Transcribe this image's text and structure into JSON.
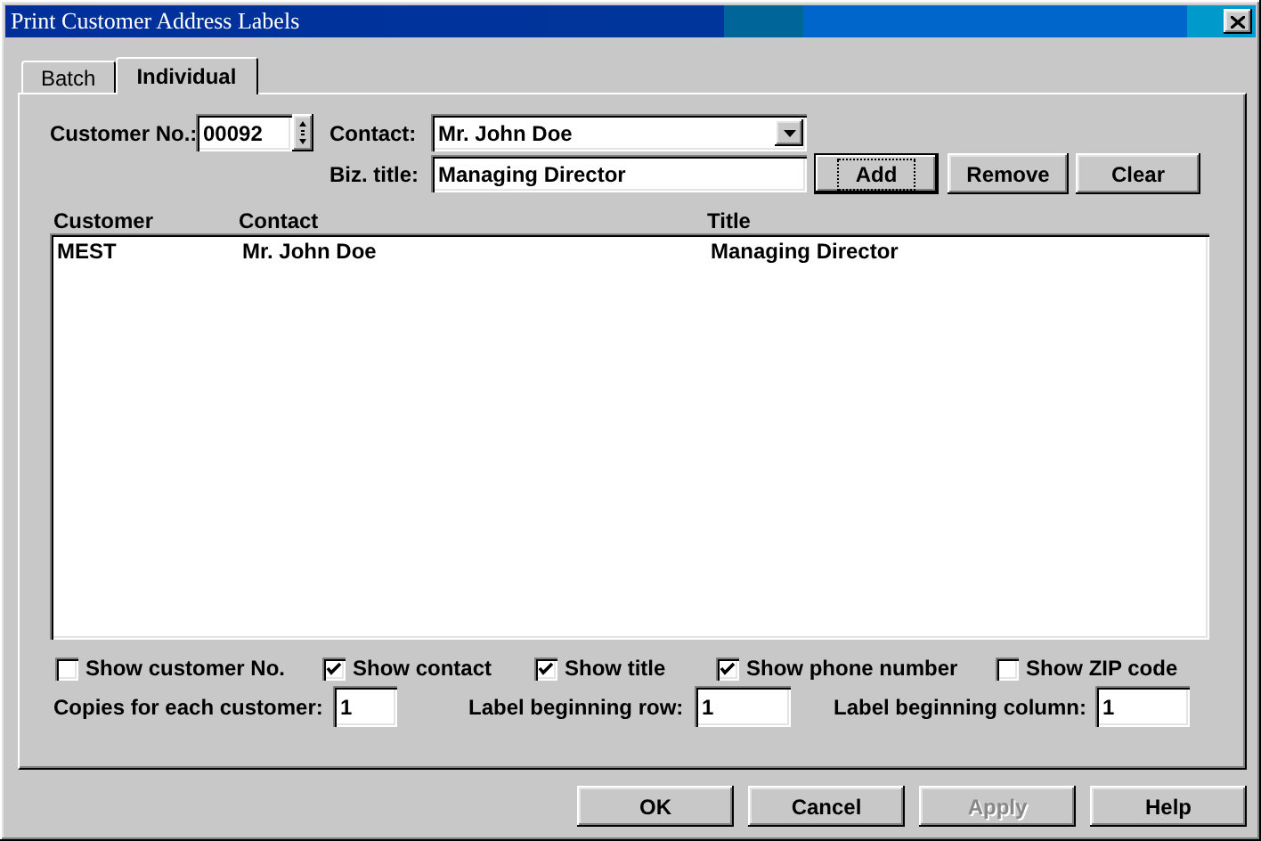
{
  "window": {
    "title": "Print Customer Address Labels"
  },
  "tabs": [
    {
      "label": "Batch",
      "selected": false
    },
    {
      "label": "Individual",
      "selected": true
    }
  ],
  "customer_no": {
    "label": "Customer No.:",
    "value": "00092"
  },
  "contact": {
    "label": "Contact:",
    "value": "Mr. John Doe"
  },
  "biz_title": {
    "label": "Biz. title:",
    "value": "Managing Director"
  },
  "actions": [
    {
      "label": "Add",
      "focused": true
    },
    {
      "label": "Remove",
      "focused": false
    },
    {
      "label": "Clear",
      "focused": false
    }
  ],
  "list": {
    "columns": [
      "Customer",
      "Contact",
      "Title"
    ],
    "rows": [
      [
        "MEST",
        "Mr. John Doe",
        "Managing Director"
      ]
    ]
  },
  "options": [
    {
      "label": "Show customer No.",
      "checked": false
    },
    {
      "label": "Show contact",
      "checked": true
    },
    {
      "label": "Show title",
      "checked": true
    },
    {
      "label": "Show phone number",
      "checked": true
    },
    {
      "label": "Show ZIP code",
      "checked": false
    }
  ],
  "numbers": [
    {
      "label": "Copies for each customer:",
      "value": "1"
    },
    {
      "label": "Label beginning row:",
      "value": "1"
    },
    {
      "label": "Label beginning column:",
      "value": "1"
    }
  ],
  "footer_buttons": [
    {
      "label": "OK",
      "disabled": false
    },
    {
      "label": "Cancel",
      "disabled": false
    },
    {
      "label": "Apply",
      "disabled": true
    },
    {
      "label": "Help",
      "disabled": false
    }
  ]
}
